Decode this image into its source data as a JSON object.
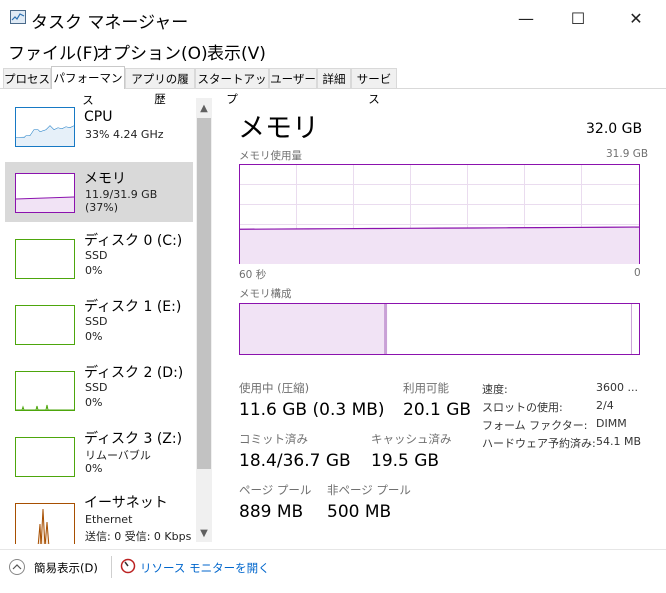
{
  "window": {
    "title": "タスク マネージャー",
    "controls": {
      "minimize": "—",
      "maximize": "☐",
      "close": "✕"
    }
  },
  "menu": [
    "ファイル(F)",
    "オプション(O)",
    "表示(V)"
  ],
  "tabs": [
    "プロセス",
    "パフォーマンス",
    "アプリの履歴",
    "スタートアップ",
    "ユーザー",
    "詳細",
    "サービス"
  ],
  "active_tab": "パフォーマンス",
  "sidebar": {
    "items": [
      {
        "name": "CPU",
        "sub1": "33%  4.24 GHz",
        "sub2": "",
        "color": "#1779c4"
      },
      {
        "name": "メモリ",
        "sub1": "11.9/31.9 GB (37%)",
        "sub2": "",
        "color": "#8b12ae"
      },
      {
        "name": "ディスク 0 (C:)",
        "sub1": "SSD",
        "sub2": "0%",
        "color": "#4da60c"
      },
      {
        "name": "ディスク 1 (E:)",
        "sub1": "SSD",
        "sub2": "0%",
        "color": "#4da60c"
      },
      {
        "name": "ディスク 2 (D:)",
        "sub1": "SSD",
        "sub2": "0%",
        "color": "#4da60c"
      },
      {
        "name": "ディスク 3 (Z:)",
        "sub1": "リムーバブル",
        "sub2": "0%",
        "color": "#4da60c"
      },
      {
        "name": "イーサネット",
        "sub1": "Ethernet",
        "sub2": "送信: 0 受信: 0 Kbps",
        "color": "#a74f01"
      }
    ],
    "selected": "メモリ",
    "scroll_up_icon": "▲",
    "scroll_down_icon": "▼"
  },
  "detail": {
    "title": "メモリ",
    "total": "32.0 GB",
    "usage_label": "メモリ使用量",
    "usage_max": "31.9 GB",
    "axis_left": "60 秒",
    "axis_right": "0",
    "composition_label": "メモリ構成",
    "stats": {
      "in_use_label": "使用中 (圧縮)",
      "in_use_value": "11.6 GB (0.3 MB)",
      "available_label": "利用可能",
      "available_value": "20.1 GB",
      "committed_label": "コミット済み",
      "committed_value": "18.4/36.7 GB",
      "cached_label": "キャッシュ済み",
      "cached_value": "19.5 GB",
      "paged_label": "ページ プール",
      "paged_value": "889 MB",
      "nonpaged_label": "非ページ プール",
      "nonpaged_value": "500 MB"
    },
    "specs": [
      {
        "label": "速度:",
        "value": "3600 ..."
      },
      {
        "label": "スロットの使用:",
        "value": "2/4"
      },
      {
        "label": "フォーム ファクター:",
        "value": "DIMM"
      },
      {
        "label": "ハードウェア予約済み:",
        "value": "54.1 MB"
      }
    ]
  },
  "memory_usage_series": {
    "max": 31.9,
    "start": 11.2,
    "end": 11.9
  },
  "memory_composition": {
    "in_use": 11.6,
    "modified": 0.1,
    "standby": 19.5,
    "free": 0.6
  },
  "footer": {
    "fewer_details": "簡易表示(D)",
    "fewer_icon": "chevron-up-icon",
    "resource_monitor": "リソース モニターを開く"
  },
  "colors": {
    "memory": "#8b12ae",
    "cpu": "#1779c4",
    "disk": "#4da60c",
    "ethernet": "#a74f01",
    "grid": "#e8d4ee"
  }
}
